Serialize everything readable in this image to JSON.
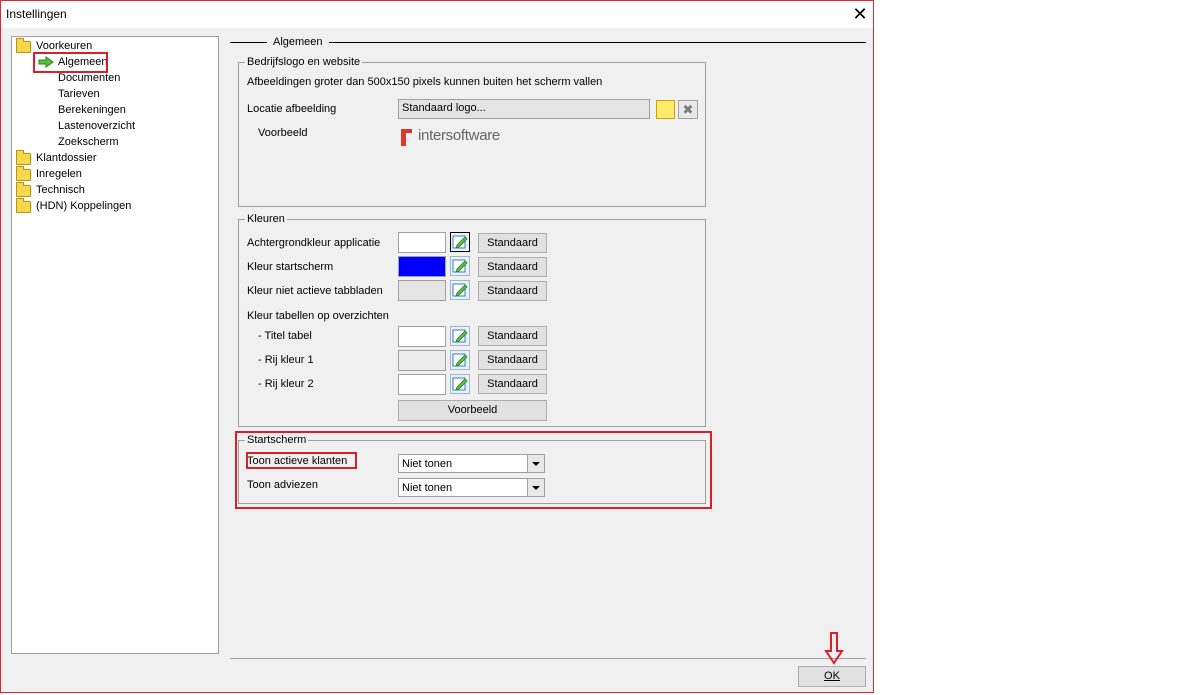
{
  "window": {
    "title": "Instellingen"
  },
  "tree": {
    "items": [
      {
        "label": "Voorkeuren",
        "icon": "folder-icon"
      },
      {
        "label": "Algemeen",
        "icon": "arrow-right-icon"
      },
      {
        "label": "Documenten"
      },
      {
        "label": "Tarieven"
      },
      {
        "label": "Berekeningen"
      },
      {
        "label": "Lastenoverzicht"
      },
      {
        "label": "Zoekscherm"
      },
      {
        "label": "Klantdossier",
        "icon": "folder-icon"
      },
      {
        "label": "Inregelen",
        "icon": "folder-icon"
      },
      {
        "label": "Technisch",
        "icon": "folder-icon"
      },
      {
        "label": "(HDN) Koppelingen",
        "icon": "folder-icon"
      }
    ]
  },
  "section": {
    "title": "Algemeen"
  },
  "logo_group": {
    "title": "Bedrijfslogo en website",
    "note": "Afbeeldingen groter dan 500x150 pixels kunnen buiten het scherm vallen",
    "location_label": "Locatie afbeelding",
    "location_value": "Standaard logo...",
    "preview_label": "Voorbeeld",
    "preview_logo_text": "intersoftware"
  },
  "colors_group": {
    "title": "Kleuren",
    "rows": [
      {
        "label": "Achtergrondkleur applicatie",
        "color": "#ffffff",
        "button": "Standaard"
      },
      {
        "label": "Kleur startscherm",
        "color": "#0000ff",
        "button": "Standaard"
      },
      {
        "label": "Kleur niet actieve tabbladen",
        "color": "#e4e4e4",
        "button": "Standaard"
      }
    ],
    "tables_label": "Kleur tabellen op overzichten",
    "table_rows": [
      {
        "label": "- Titel tabel",
        "color": "#ffffff",
        "button": "Standaard"
      },
      {
        "label": "- Rij kleur 1",
        "color": "#ececec",
        "button": "Standaard"
      },
      {
        "label": "- Rij kleur 2",
        "color": "#ffffff",
        "button": "Standaard"
      }
    ],
    "preview_button": "Voorbeeld"
  },
  "start_group": {
    "title": "Startscherm",
    "rows": [
      {
        "label": "Toon actieve klanten",
        "value": "Niet tonen"
      },
      {
        "label": "Toon adviezen",
        "value": "Niet tonen"
      }
    ]
  },
  "footer": {
    "ok_label": "OK"
  },
  "colors": {
    "highlight": "#d8202b",
    "brand": "#d9382c"
  }
}
